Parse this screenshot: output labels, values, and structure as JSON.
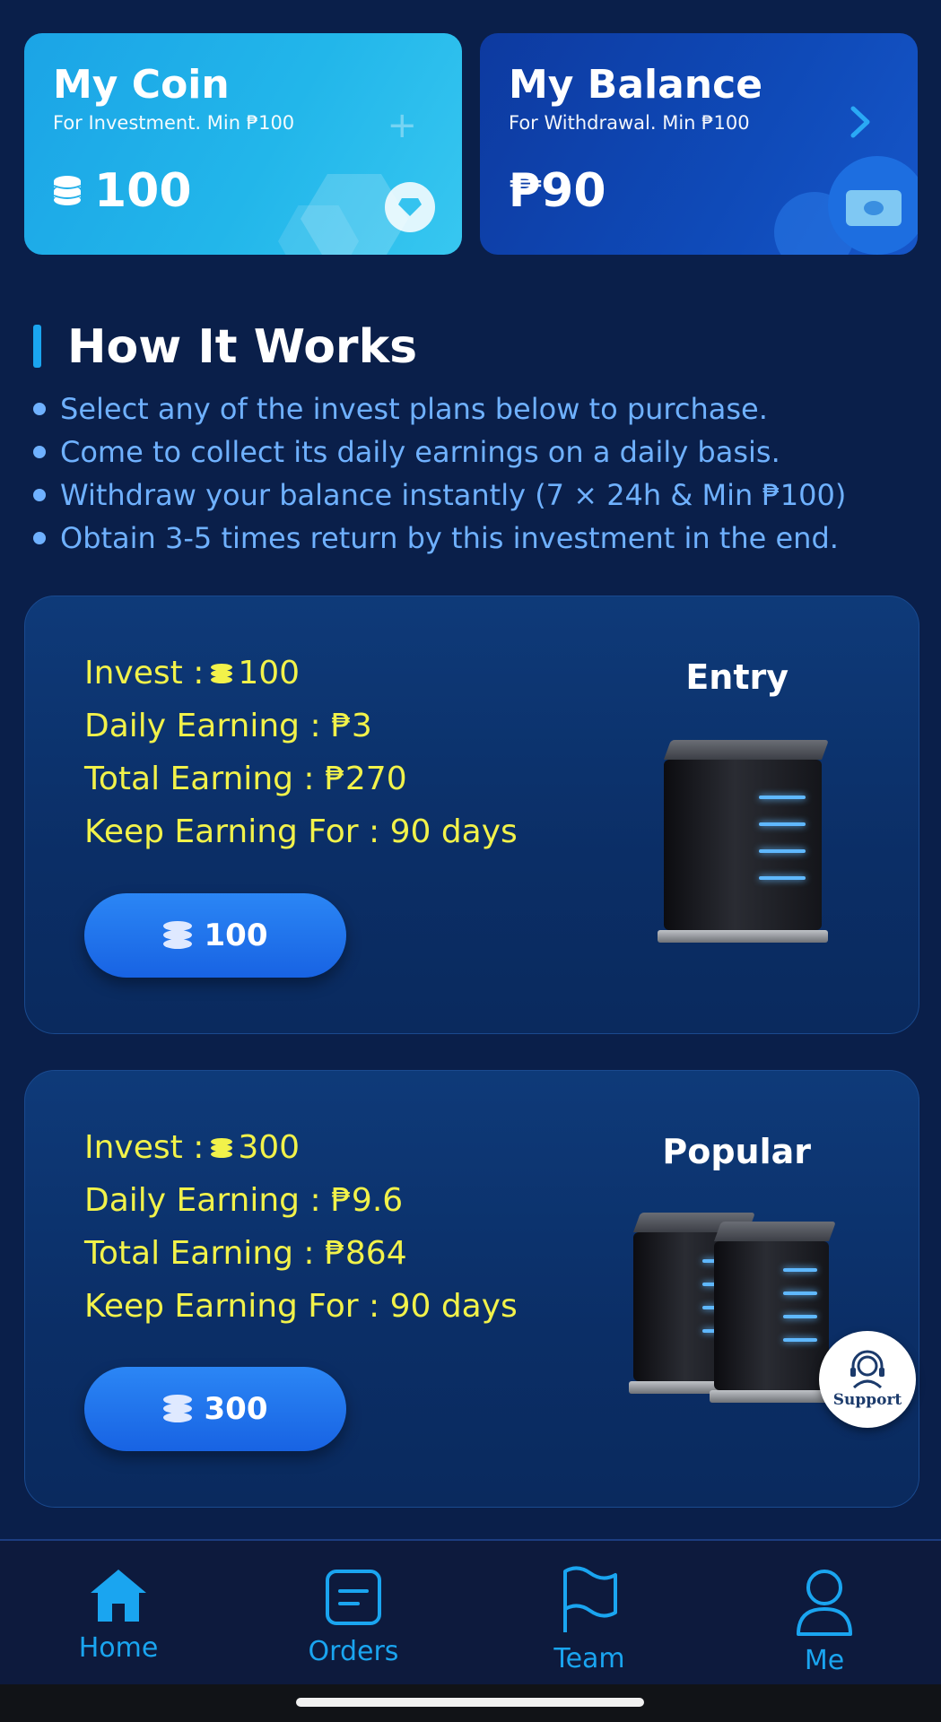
{
  "coin_card": {
    "title": "My Coin",
    "subtitle": "For Investment. Min ₱100",
    "value": "100",
    "icon": "plus-icon"
  },
  "balance_card": {
    "title": "My Balance",
    "subtitle": "For Withdrawal. Min ₱100",
    "value": "₱90",
    "icon": "chevron-right-icon"
  },
  "how_it_works": {
    "title": "How It Works",
    "steps": [
      "Select any of the invest plans below to purchase.",
      "Come to collect its daily earnings on a daily basis.",
      "Withdraw your balance instantly (7 × 24h & Min ₱100)",
      "Obtain 3-5 times return by this investment in the end."
    ]
  },
  "plans": [
    {
      "tier": "Entry",
      "invest_label": "Invest :",
      "invest_value": "100",
      "daily_earning": "Daily Earning : ₱3",
      "total_earning": "Total Earning : ₱270",
      "duration": "Keep Earning For : 90 days",
      "button_label": "100"
    },
    {
      "tier": "Popular",
      "invest_label": "Invest :",
      "invest_value": "300",
      "daily_earning": "Daily Earning : ₱9.6",
      "total_earning": "Total Earning : ₱864",
      "duration": "Keep Earning For : 90 days",
      "button_label": "300"
    }
  ],
  "support": {
    "label": "Support"
  },
  "nav": {
    "items": [
      {
        "label": "Home",
        "icon": "home-icon",
        "active": true
      },
      {
        "label": "Orders",
        "icon": "orders-icon"
      },
      {
        "label": "Team",
        "icon": "flag-icon"
      },
      {
        "label": "Me",
        "icon": "user-icon"
      }
    ]
  },
  "colors": {
    "background": "#0a1f4a",
    "accent": "#1aa5f0",
    "plan_text": "#f2f24a",
    "hiw_text": "#6fb1ff"
  }
}
